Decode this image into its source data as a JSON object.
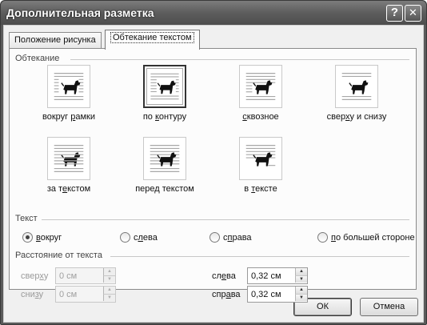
{
  "window": {
    "title": "Дополнительная разметка",
    "help_glyph": "?",
    "close_glyph": "✕"
  },
  "tabs": [
    {
      "label": "Положение рисунка",
      "active": false
    },
    {
      "label": "Обтекание текстом",
      "active": true
    }
  ],
  "wrapping": {
    "title": "Обтекание",
    "options": [
      {
        "pre": "вокруг ",
        "u": "р",
        "post": "амки",
        "icon": "square-wrap-icon",
        "selected": false
      },
      {
        "pre": "по ",
        "u": "к",
        "post": "онтуру",
        "icon": "tight-wrap-icon",
        "selected": true
      },
      {
        "pre": "",
        "u": "с",
        "post": "квозное",
        "icon": "through-wrap-icon",
        "selected": false
      },
      {
        "pre": "свер",
        "u": "х",
        "post": "у и снизу",
        "icon": "top-bottom-wrap-icon",
        "selected": false
      },
      {
        "pre": "за т",
        "u": "е",
        "post": "кстом",
        "icon": "behind-text-icon",
        "selected": false
      },
      {
        "pre": "пере",
        "u": "д",
        "post": " текстом",
        "icon": "in-front-text-icon",
        "selected": false
      },
      {
        "pre": "в ",
        "u": "т",
        "post": "ексте",
        "icon": "inline-text-icon",
        "selected": false
      }
    ]
  },
  "text_side": {
    "title": "Текст",
    "options": [
      {
        "pre": "",
        "u": "в",
        "post": "округ",
        "checked": true
      },
      {
        "pre": "с",
        "u": "л",
        "post": "ева",
        "checked": false
      },
      {
        "pre": "с",
        "u": "п",
        "post": "рава",
        "checked": false
      },
      {
        "pre": "",
        "u": "п",
        "post": "о большей стороне",
        "checked": false
      }
    ]
  },
  "distance": {
    "title": "Расстояние от текста",
    "top": {
      "pre": "свер",
      "u": "х",
      "post": "у",
      "value": "0 см",
      "enabled": false
    },
    "bottom": {
      "pre": "сни",
      "u": "з",
      "post": "у",
      "value": "0 см",
      "enabled": false
    },
    "left": {
      "pre": "сл",
      "u": "е",
      "post": "ва",
      "value": "0,32 см",
      "enabled": true
    },
    "right": {
      "pre": "спр",
      "u": "а",
      "post": "ва",
      "value": "0,32 см",
      "enabled": true
    }
  },
  "buttons": {
    "ok": "ОК",
    "cancel": "Отмена"
  },
  "spin_arrows": {
    "up": "▲",
    "down": "▼"
  }
}
